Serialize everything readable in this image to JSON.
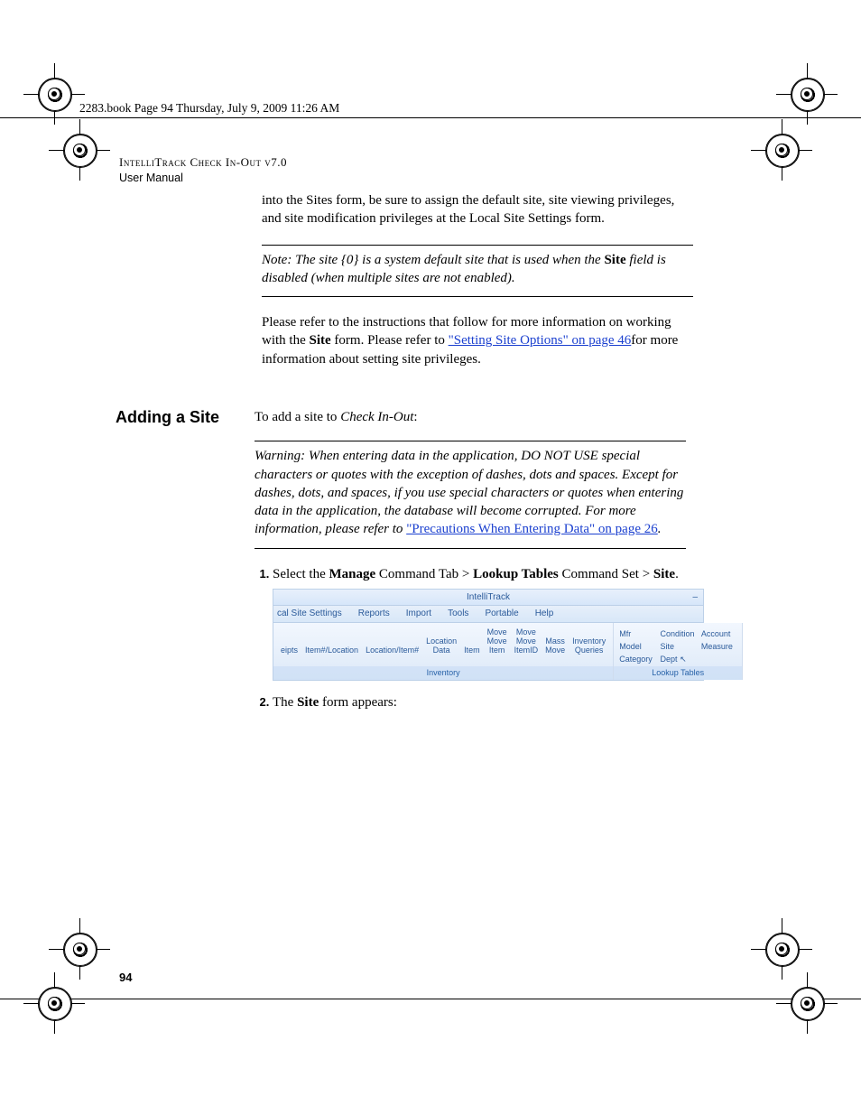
{
  "header_line": "2283.book  Page 94  Thursday, July 9, 2009  11:26 AM",
  "book": {
    "title": "IntelliTrack Check In-Out v7.0",
    "subtitle": "User Manual"
  },
  "intro_para": "into the Sites form, be sure to assign the default site, site viewing privileges, and site modification privileges at the Local Site Settings form.",
  "note": {
    "prefix": "Note:   The site {0} is a system default site that is used when the ",
    "bold": "Site",
    "suffix": " field is disabled (when multiple sites are not enabled)."
  },
  "refer": {
    "p1": "Please refer to the instructions that follow for more information on working with the ",
    "bold": "Site",
    "p2": " form. Please refer to ",
    "link": "\"Setting Site Options\" on page 46",
    "p3": "for more information about setting site privileges."
  },
  "section": {
    "heading": "Adding a Site",
    "lead_p1": "To add a site to ",
    "lead_em": "Check In-Out",
    "lead_p3": ":"
  },
  "warning": {
    "prefix": "Warning:   When entering data in the application, DO NOT USE special characters or quotes with the exception of dashes, dots and spaces. Except for dashes, dots, and spaces, if you use special characters or quotes when entering data in the application, the database will become corrupted. For more information, please refer to ",
    "link": "\"Precautions When Entering Data\" on page 26",
    "suffix": "."
  },
  "steps": {
    "s1": {
      "a": "Select the ",
      "b1": "Manage",
      "c": " Command Tab > ",
      "b2": "Lookup Tables",
      "d": " Command Set > ",
      "b3": "Site",
      "e": "."
    },
    "s2": {
      "a": "The ",
      "b": "Site",
      "c": " form appears:"
    }
  },
  "ui": {
    "title": "IntelliTrack",
    "menu": [
      "cal Site Settings",
      "Reports",
      "Import",
      "Tools",
      "Portable",
      "Help"
    ],
    "inv_buttons": [
      "eipts",
      "Item#/Location",
      "Location/Item#",
      "Location\nData",
      "Item",
      "Move\nMove Item",
      "Move Move\nItemID",
      "Mass\nMove",
      "Inventory Queries"
    ],
    "inv_label": "Inventory",
    "lookup": [
      "Mfr",
      "Condition",
      "Account",
      "Model",
      "Site",
      "Measure",
      "Category",
      "Dept"
    ],
    "lookup_label": "Lookup Tables"
  },
  "page_number": "94"
}
